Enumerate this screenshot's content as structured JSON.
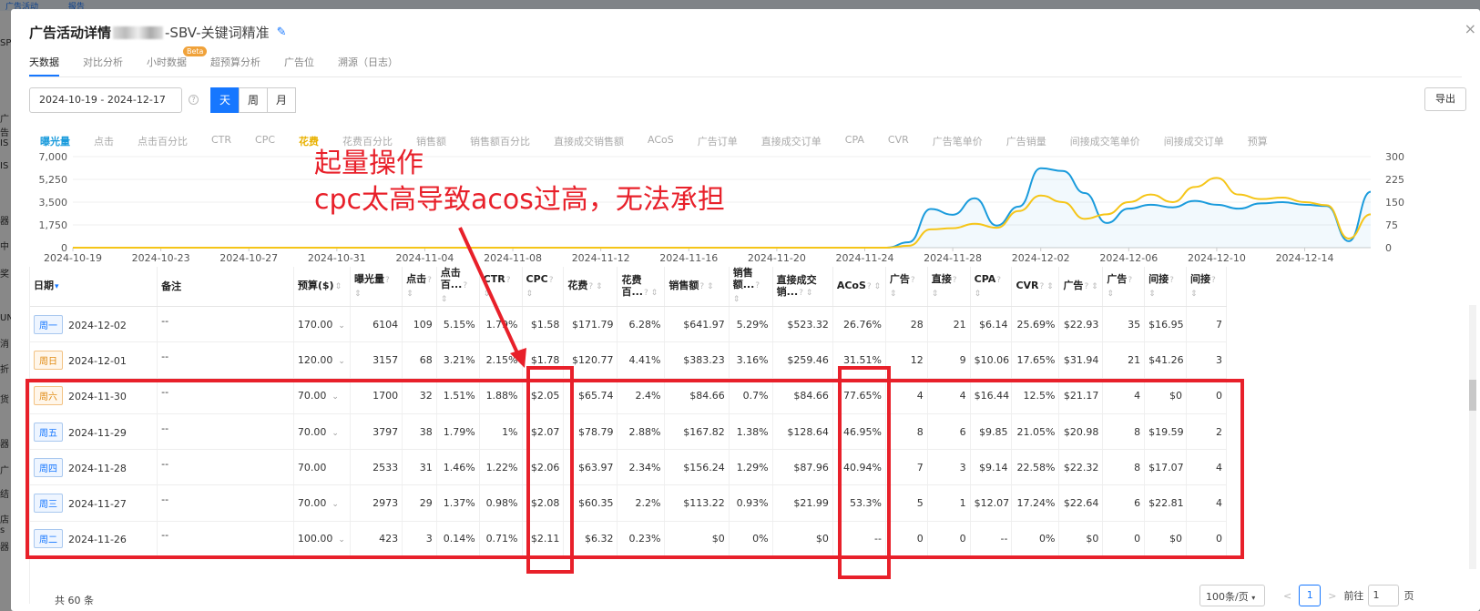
{
  "background": {
    "top_tabs": [
      "广告活动",
      "报告"
    ],
    "side_fragments": [
      "SP",
      "广告",
      "IS",
      "IS",
      "器",
      "中",
      "奖",
      "UN",
      "消",
      "折",
      "货",
      "器",
      "广",
      "结",
      "店 s",
      "器"
    ]
  },
  "modal": {
    "title_prefix": "广告活动详情",
    "title_suffix": "-SBV-关键词精准",
    "close": "×"
  },
  "tabs": [
    {
      "label": "天数据",
      "active": true
    },
    {
      "label": "对比分析"
    },
    {
      "label": "小时数据",
      "badge": "Beta"
    },
    {
      "label": "超预算分析"
    },
    {
      "label": "广告位"
    },
    {
      "label": "溯源（日志）"
    }
  ],
  "filters": {
    "date_range": "2024-10-19 - 2024-12-17",
    "help": "?",
    "granularity": [
      "天",
      "周",
      "月"
    ],
    "granularity_selected": "天",
    "export_label": "导出"
  },
  "metrics": {
    "items": [
      "曝光量",
      "点击",
      "点击百分比",
      "CTR",
      "CPC",
      "花费",
      "花费百分比",
      "销售额",
      "销售额百分比",
      "直接成交销售额",
      "ACoS",
      "广告订单",
      "直接成交订单",
      "CPA",
      "CVR",
      "广告笔单价",
      "广告销量",
      "间接成交笔单价",
      "间接成交订单",
      "预算"
    ],
    "selected": [
      "曝光量",
      "花费"
    ]
  },
  "chart_data": {
    "type": "line",
    "x_ticks": [
      "2024-10-19",
      "2024-10-23",
      "2024-10-27",
      "2024-10-31",
      "2024-11-04",
      "2024-11-08",
      "2024-11-12",
      "2024-11-16",
      "2024-11-20",
      "2024-11-24",
      "2024-11-28",
      "2024-12-02",
      "2024-12-06",
      "2024-12-10",
      "2024-12-14"
    ],
    "y_left_ticks": [
      "0",
      "1,750",
      "3,500",
      "5,250",
      "7,000"
    ],
    "y_right_ticks": [
      "0",
      "75",
      "150",
      "225",
      "300"
    ],
    "ylim_left": [
      0,
      7000
    ],
    "ylim_right": [
      0,
      300
    ],
    "series": [
      {
        "name": "曝光量",
        "axis": "left",
        "color": "#1a9bdc",
        "points": [
          [
            "2024-11-25",
            0
          ],
          [
            "2024-11-26",
            423
          ],
          [
            "2024-11-27",
            2973
          ],
          [
            "2024-11-28",
            2533
          ],
          [
            "2024-11-29",
            3797
          ],
          [
            "2024-11-30",
            1700
          ],
          [
            "2024-12-01",
            3157
          ],
          [
            "2024-12-02",
            6104
          ],
          [
            "2024-12-03",
            5900
          ],
          [
            "2024-12-04",
            4200
          ],
          [
            "2024-12-05",
            1900
          ],
          [
            "2024-12-06",
            3000
          ],
          [
            "2024-12-07",
            3300
          ],
          [
            "2024-12-08",
            3100
          ],
          [
            "2024-12-09",
            3600
          ],
          [
            "2024-12-10",
            3300
          ],
          [
            "2024-12-11",
            3000
          ],
          [
            "2024-12-12",
            3400
          ],
          [
            "2024-12-13",
            3500
          ],
          [
            "2024-12-14",
            3300
          ],
          [
            "2024-12-15",
            3200
          ],
          [
            "2024-12-16",
            500
          ],
          [
            "2024-12-17",
            4300
          ]
        ]
      },
      {
        "name": "花费",
        "axis": "right",
        "color": "#f5c518",
        "points": [
          [
            "2024-11-25",
            0
          ],
          [
            "2024-11-26",
            6.32
          ],
          [
            "2024-11-27",
            60.35
          ],
          [
            "2024-11-28",
            63.97
          ],
          [
            "2024-11-29",
            78.79
          ],
          [
            "2024-11-30",
            65.74
          ],
          [
            "2024-12-01",
            120.77
          ],
          [
            "2024-12-02",
            171.79
          ],
          [
            "2024-12-03",
            150
          ],
          [
            "2024-12-04",
            95
          ],
          [
            "2024-12-05",
            110
          ],
          [
            "2024-12-06",
            150
          ],
          [
            "2024-12-07",
            175
          ],
          [
            "2024-12-08",
            150
          ],
          [
            "2024-12-09",
            200
          ],
          [
            "2024-12-10",
            230
          ],
          [
            "2024-12-11",
            175
          ],
          [
            "2024-12-12",
            160
          ],
          [
            "2024-12-13",
            165
          ],
          [
            "2024-12-14",
            150
          ],
          [
            "2024-12-15",
            140
          ],
          [
            "2024-12-16",
            30
          ],
          [
            "2024-12-17",
            110
          ]
        ]
      }
    ]
  },
  "table": {
    "headers": [
      "日期",
      "备注",
      "预算($)",
      "曝光量",
      "点击",
      "点击百...",
      "CTR",
      "CPC",
      "花费",
      "花费百...",
      "销售额",
      "销售额...",
      "直接成交销...",
      "ACoS",
      "广告",
      "直接",
      "CPA",
      "CVR",
      "广告",
      "广告",
      "间接",
      "间接"
    ],
    "rows": [
      {
        "weekday": "周一",
        "weekend": false,
        "date": "2024-12-02",
        "note": "--",
        "budget": "170.00",
        "budget_caret": "⌄",
        "cells": [
          "6104",
          "109",
          "5.15%",
          "1.79%",
          "$1.58",
          "$171.79",
          "6.28%",
          "$641.97",
          "5.29%",
          "$523.32",
          "26.76%",
          "28",
          "21",
          "$6.14",
          "25.69%",
          "$22.93",
          "35",
          "$16.95",
          "7"
        ]
      },
      {
        "weekday": "周日",
        "weekend": true,
        "date": "2024-12-01",
        "note": "--",
        "budget": "120.00",
        "budget_caret": "⌄",
        "cells": [
          "3157",
          "68",
          "3.21%",
          "2.15%",
          "$1.78",
          "$120.77",
          "4.41%",
          "$383.23",
          "3.16%",
          "$259.46",
          "31.51%",
          "12",
          "9",
          "$10.06",
          "17.65%",
          "$31.94",
          "21",
          "$41.26",
          "3"
        ]
      },
      {
        "weekday": "周六",
        "weekend": true,
        "date": "2024-11-30",
        "note": "--",
        "budget": "70.00",
        "budget_caret": "⌄",
        "cells": [
          "1700",
          "32",
          "1.51%",
          "1.88%",
          "$2.05",
          "$65.74",
          "2.4%",
          "$84.66",
          "0.7%",
          "$84.66",
          "77.65%",
          "4",
          "4",
          "$16.44",
          "12.5%",
          "$21.17",
          "4",
          "$0",
          "0"
        ]
      },
      {
        "weekday": "周五",
        "weekend": false,
        "date": "2024-11-29",
        "note": "--",
        "budget": "70.00",
        "budget_caret": "⌄",
        "cells": [
          "3797",
          "38",
          "1.79%",
          "1%",
          "$2.07",
          "$78.79",
          "2.88%",
          "$167.82",
          "1.38%",
          "$128.64",
          "46.95%",
          "8",
          "6",
          "$9.85",
          "21.05%",
          "$20.98",
          "8",
          "$19.59",
          "2"
        ]
      },
      {
        "weekday": "周四",
        "weekend": false,
        "date": "2024-11-28",
        "note": "--",
        "budget": "70.00",
        "budget_caret": "",
        "cells": [
          "2533",
          "31",
          "1.46%",
          "1.22%",
          "$2.06",
          "$63.97",
          "2.34%",
          "$156.24",
          "1.29%",
          "$87.96",
          "40.94%",
          "7",
          "3",
          "$9.14",
          "22.58%",
          "$22.32",
          "8",
          "$17.07",
          "4"
        ]
      },
      {
        "weekday": "周三",
        "weekend": false,
        "date": "2024-11-27",
        "note": "--",
        "budget": "70.00",
        "budget_caret": "⌄",
        "cells": [
          "2973",
          "29",
          "1.37%",
          "0.98%",
          "$2.08",
          "$60.35",
          "2.2%",
          "$113.22",
          "0.93%",
          "$21.99",
          "53.3%",
          "5",
          "1",
          "$12.07",
          "17.24%",
          "$22.64",
          "6",
          "$22.81",
          "4"
        ]
      },
      {
        "weekday": "周二",
        "weekend": false,
        "date": "2024-11-26",
        "note": "--",
        "budget": "100.00",
        "budget_caret": "⌄",
        "cells": [
          "423",
          "3",
          "0.14%",
          "0.71%",
          "$2.11",
          "$6.32",
          "0.23%",
          "$0",
          "0%",
          "$0",
          "--",
          "0",
          "0",
          "--",
          "0%",
          "$0",
          "0",
          "$0",
          "0"
        ]
      }
    ]
  },
  "footer": {
    "total": "共 60 条",
    "page_size": "100条/页",
    "prev": "<",
    "current_page": "1",
    "next": ">",
    "goto_label": "前往",
    "goto_value": "1",
    "page_suffix": "页"
  },
  "annotation": {
    "line1": "起量操作",
    "line2": "cpc太高导致acos过高，无法承担",
    "color": "#e8202a"
  }
}
